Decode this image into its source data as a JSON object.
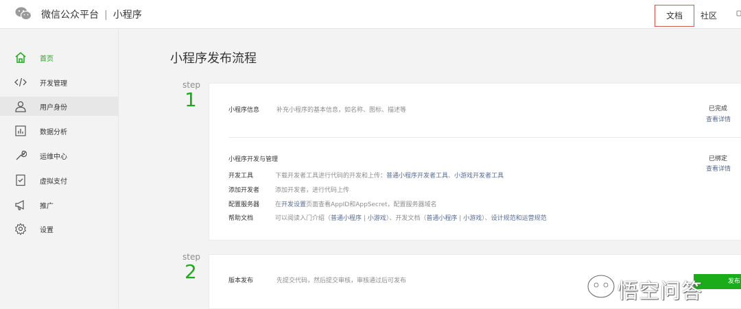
{
  "header": {
    "brand": "微信公众平台",
    "separator": "|",
    "product": "小程序",
    "doc_link": "文档",
    "community_link": "社区",
    "icons": {
      "logo": "wechat-logo-icon"
    }
  },
  "sidebar": {
    "items": [
      {
        "label": "首页",
        "icon": "home-icon",
        "active": true
      },
      {
        "label": "开发管理",
        "icon": "code-icon"
      },
      {
        "label": "用户身份",
        "icon": "user-icon",
        "highlighted": true
      },
      {
        "label": "数据分析",
        "icon": "chart-icon"
      },
      {
        "label": "运维中心",
        "icon": "wrench-icon"
      },
      {
        "label": "虚拟支付",
        "icon": "payment-icon"
      },
      {
        "label": "推广",
        "icon": "megaphone-icon"
      },
      {
        "label": "设置",
        "icon": "gear-icon"
      }
    ]
  },
  "main": {
    "title": "小程序发布流程",
    "steps": [
      {
        "word": "step",
        "number": "1",
        "sections": {
          "info": {
            "title": "小程序信息",
            "desc": "补充小程序的基本信息，如名称、图标、描述等",
            "status": "已完成",
            "detail": "查看详情"
          },
          "dev": {
            "title": "小程序开发与管理",
            "status": "已绑定",
            "detail": "查看详情",
            "rows": [
              {
                "label": "开发工具",
                "text": "下载开发者工具进行代码的开发和上传：",
                "link1": "普通小程序开发者工具",
                "sep": "、",
                "link2": "小游戏开发者工具"
              },
              {
                "label": "添加开发者",
                "text": "添加开发者，进行代码上传"
              },
              {
                "label": "配置服务器",
                "text_pre": "在",
                "link": "开发设置",
                "text_post": "页面查看AppID和AppSecret，配置服务器域名"
              },
              {
                "label": "帮助文档",
                "text_pre": "可以阅读入门介绍（",
                "l1": "普通小程序",
                "bar1": " | ",
                "l2": "小游戏",
                "mid": "）、开发文档（",
                "l3": "普通小程序",
                "bar2": " | ",
                "l4": "小游戏",
                "end1": "）、",
                "l5": "设计规范",
                "and": "和",
                "l6": "运营规范"
              }
            ]
          }
        }
      },
      {
        "word": "step",
        "number": "2",
        "sections": {
          "release": {
            "title": "版本发布",
            "desc": "先提交代码，然后提交审核，审核通过后可发布",
            "button": "发布"
          }
        }
      }
    ]
  },
  "watermark": {
    "text": "悟空问答",
    "icon": "wukong-logo-icon"
  },
  "colors": {
    "accent": "#1aad19",
    "link": "#576b95",
    "highlight_border": "#d9534f"
  }
}
